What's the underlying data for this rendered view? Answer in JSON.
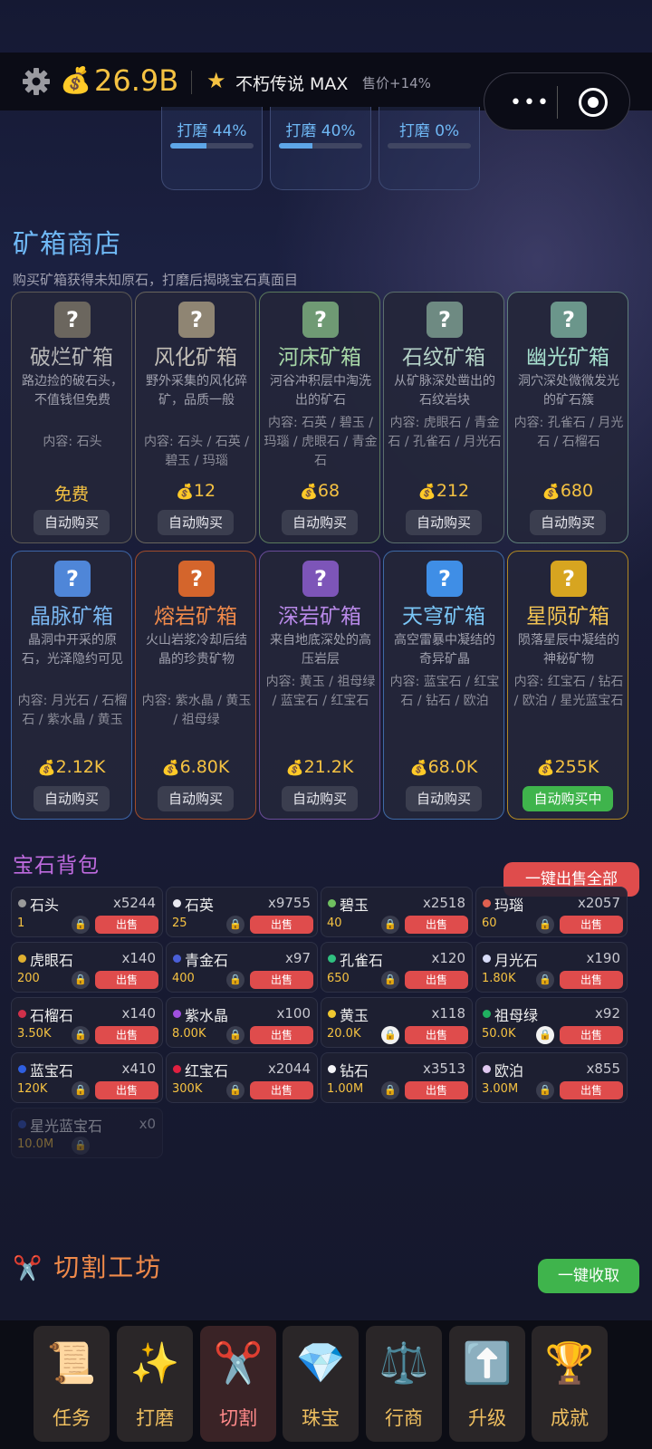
{
  "header": {
    "money": "26.9B",
    "rank": "不朽传说 MAX",
    "sell_bonus": "售价+14%",
    "icons": {
      "settings": "gear-icon",
      "coin": "money-bag-icon",
      "rank": "star-icon"
    }
  },
  "polish_slots": [
    {
      "label": "打磨 44%",
      "progress": 0.44
    },
    {
      "label": "打磨 40%",
      "progress": 0.4
    },
    {
      "label": "打磨 0%",
      "progress": 0.0
    }
  ],
  "shop": {
    "title": "矿箱商店",
    "subtitle": "购买矿箱获得未知原石，打磨后揭晓宝石真面目",
    "boxes": [
      {
        "name": "破烂矿箱",
        "desc": "路边捡的破石头，不值钱但免费",
        "contents": "内容: 石头",
        "price": "免费",
        "auto": "自动购买",
        "color": "#b8b8b8",
        "qcolor": "#6b665e",
        "border": "#5d5a55"
      },
      {
        "name": "风化矿箱",
        "desc": "野外采集的风化碎矿，品质一般",
        "contents": "内容: 石头 / 石英 / 碧玉 / 玛瑙",
        "price": "12",
        "auto": "自动购买",
        "color": "#c4c0b8",
        "qcolor": "#8f8573",
        "border": "#6a665d"
      },
      {
        "name": "河床矿箱",
        "desc": "河谷冲积层中淘洗出的矿石",
        "contents": "内容: 石英 / 碧玉 / 玛瑙 / 虎眼石 / 青金石",
        "price": "68",
        "auto": "自动购买",
        "color": "#a8d9a8",
        "qcolor": "#6f9a74",
        "border": "#5b7a5c"
      },
      {
        "name": "石纹矿箱",
        "desc": "从矿脉深处凿出的石纹岩块",
        "contents": "内容: 虎眼石 / 青金石 / 孔雀石 / 月光石",
        "price": "212",
        "auto": "自动购买",
        "color": "#b5d3c8",
        "qcolor": "#6e8a82",
        "border": "#5b6f6c"
      },
      {
        "name": "幽光矿箱",
        "desc": "洞穴深处微微发光的矿石簇",
        "contents": "内容: 孔雀石 / 月光石 / 石榴石",
        "price": "680",
        "auto": "自动购买",
        "color": "#a7e0cf",
        "qcolor": "#6b968b",
        "border": "#5e7f78"
      },
      {
        "name": "晶脉矿箱",
        "desc": "晶洞中开采的原石，光泽隐约可见",
        "contents": "内容: 月光石 / 石榴石 / 紫水晶 / 黄玉",
        "price": "2.12K",
        "auto": "自动购买",
        "color": "#7ab6f0",
        "qcolor": "#4f86d8",
        "border": "#3d66a8"
      },
      {
        "name": "熔岩矿箱",
        "desc": "火山岩浆冷却后结晶的珍贵矿物",
        "contents": "内容: 紫水晶 / 黄玉 / 祖母绿",
        "price": "6.80K",
        "auto": "自动购买",
        "color": "#f08a4a",
        "qcolor": "#d4652c",
        "border": "#a24c2a"
      },
      {
        "name": "深岩矿箱",
        "desc": "来自地底深处的高压岩层",
        "contents": "内容: 黄玉 / 祖母绿 / 蓝宝石 / 红宝石",
        "price": "21.2K",
        "auto": "自动购买",
        "color": "#b889e8",
        "qcolor": "#7d55b8",
        "border": "#6a4c98"
      },
      {
        "name": "天穹矿箱",
        "desc": "高空雷暴中凝结的奇异矿晶",
        "contents": "内容: 蓝宝石 / 红宝石 / 钻石 / 欧泊",
        "price": "68.0K",
        "auto": "自动购买",
        "color": "#7ac6f6",
        "qcolor": "#3f8ee6",
        "border": "#3e6aa6"
      },
      {
        "name": "星陨矿箱",
        "desc": "陨落星辰中凝结的神秘矿物",
        "contents": "内容: 红宝石 / 钻石 / 欧泊 / 星光蓝宝石",
        "price": "255K",
        "auto": "自动购买中",
        "color": "#f3c453",
        "qcolor": "#d7a520",
        "border": "#b28a23"
      }
    ]
  },
  "bag": {
    "title": "宝石背包",
    "sell_all": "一键出售全部",
    "sell_label": "出售",
    "gems": [
      {
        "name": "石头",
        "count": "x5244",
        "price": "1",
        "dot": "#9a9a9a",
        "locked": false
      },
      {
        "name": "石英",
        "count": "x9755",
        "price": "25",
        "dot": "#e8e8f0",
        "locked": false
      },
      {
        "name": "碧玉",
        "count": "x2518",
        "price": "40",
        "dot": "#6fbf5f",
        "locked": false
      },
      {
        "name": "玛瑙",
        "count": "x2057",
        "price": "60",
        "dot": "#e06050",
        "locked": false
      },
      {
        "name": "虎眼石",
        "count": "x140",
        "price": "200",
        "dot": "#e0b030",
        "locked": false
      },
      {
        "name": "青金石",
        "count": "x97",
        "price": "400",
        "dot": "#4a5fd8",
        "locked": false
      },
      {
        "name": "孔雀石",
        "count": "x120",
        "price": "650",
        "dot": "#30c080",
        "locked": false
      },
      {
        "name": "月光石",
        "count": "x190",
        "price": "1.80K",
        "dot": "#d8dcf8",
        "locked": false
      },
      {
        "name": "石榴石",
        "count": "x140",
        "price": "3.50K",
        "dot": "#d0304a",
        "locked": false
      },
      {
        "name": "紫水晶",
        "count": "x100",
        "price": "8.00K",
        "dot": "#a050e0",
        "locked": false
      },
      {
        "name": "黄玉",
        "count": "x118",
        "price": "20.0K",
        "dot": "#f0c830",
        "locked": true
      },
      {
        "name": "祖母绿",
        "count": "x92",
        "price": "50.0K",
        "dot": "#20b060",
        "locked": true
      },
      {
        "name": "蓝宝石",
        "count": "x410",
        "price": "120K",
        "dot": "#2f5fe0",
        "locked": false
      },
      {
        "name": "红宝石",
        "count": "x2044",
        "price": "300K",
        "dot": "#e02040",
        "locked": false
      },
      {
        "name": "钻石",
        "count": "x3513",
        "price": "1.00M",
        "dot": "#f4f4f8",
        "locked": false
      },
      {
        "name": "欧泊",
        "count": "x855",
        "price": "3.00M",
        "dot": "#e0c8f0",
        "locked": false
      },
      {
        "name": "星光蓝宝石",
        "count": "x0",
        "price": "10.0M",
        "dot": "#3050b0",
        "locked": false,
        "empty": true
      }
    ]
  },
  "workshop": {
    "title": "切割工坊",
    "collect": "一键收取",
    "icon": "scissors-icon"
  },
  "nav": [
    {
      "label": "任务",
      "icon": "📜",
      "icon_name": "scroll-icon"
    },
    {
      "label": "打磨",
      "icon": "✨",
      "icon_name": "sparkles-icon"
    },
    {
      "label": "切割",
      "icon": "✂️",
      "icon_name": "scissors-icon",
      "active": true
    },
    {
      "label": "珠宝",
      "icon": "💎",
      "icon_name": "diamond-icon"
    },
    {
      "label": "行商",
      "icon": "⚖️",
      "icon_name": "scales-icon"
    },
    {
      "label": "升级",
      "icon": "⬆️",
      "icon_name": "upgrade-arrow-icon"
    },
    {
      "label": "成就",
      "icon": "🏆",
      "icon_name": "trophy-icon"
    }
  ]
}
